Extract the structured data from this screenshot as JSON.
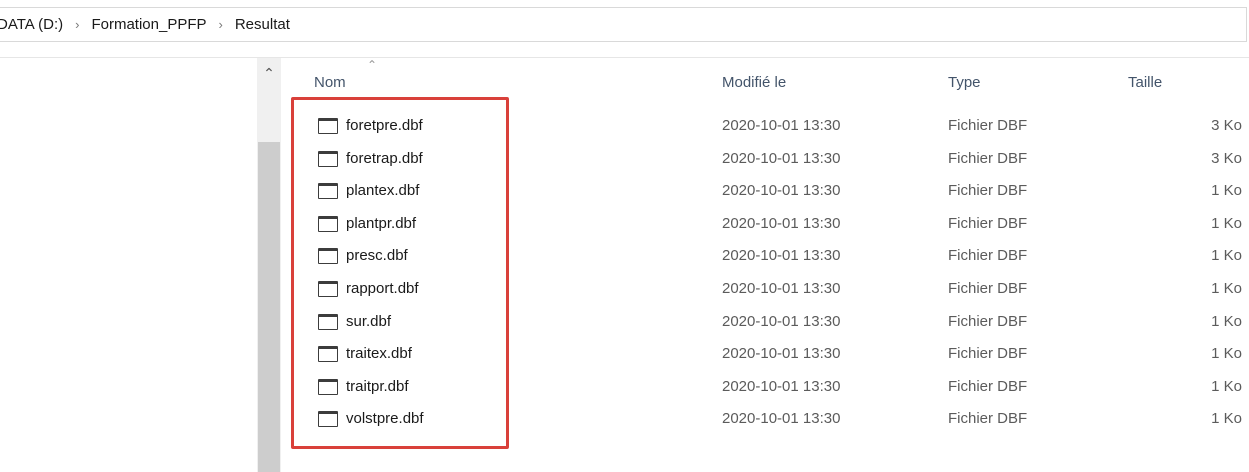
{
  "breadcrumb": {
    "items": [
      "DATA (D:)",
      "Formation_PPFP",
      "Resultat"
    ],
    "separator": "›"
  },
  "columns": {
    "name": "Nom",
    "modified": "Modifié le",
    "type": "Type",
    "size": "Taille"
  },
  "files": [
    {
      "name": "foretpre.dbf",
      "modified": "2020-10-01 13:30",
      "type": "Fichier DBF",
      "size": "3 Ko"
    },
    {
      "name": "foretrap.dbf",
      "modified": "2020-10-01 13:30",
      "type": "Fichier DBF",
      "size": "3 Ko"
    },
    {
      "name": "plantex.dbf",
      "modified": "2020-10-01 13:30",
      "type": "Fichier DBF",
      "size": "1 Ko"
    },
    {
      "name": "plantpr.dbf",
      "modified": "2020-10-01 13:30",
      "type": "Fichier DBF",
      "size": "1 Ko"
    },
    {
      "name": "presc.dbf",
      "modified": "2020-10-01 13:30",
      "type": "Fichier DBF",
      "size": "1 Ko"
    },
    {
      "name": "rapport.dbf",
      "modified": "2020-10-01 13:30",
      "type": "Fichier DBF",
      "size": "1 Ko"
    },
    {
      "name": "sur.dbf",
      "modified": "2020-10-01 13:30",
      "type": "Fichier DBF",
      "size": "1 Ko"
    },
    {
      "name": "traitex.dbf",
      "modified": "2020-10-01 13:30",
      "type": "Fichier DBF",
      "size": "1 Ko"
    },
    {
      "name": "traitpr.dbf",
      "modified": "2020-10-01 13:30",
      "type": "Fichier DBF",
      "size": "1 Ko"
    },
    {
      "name": "volstpre.dbf",
      "modified": "2020-10-01 13:30",
      "type": "Fichier DBF",
      "size": "1 Ko"
    }
  ],
  "icons": {
    "file": "file-window-icon",
    "scroll_up": "chevron-up-icon",
    "sort": "sort-ascending-icon"
  },
  "colors": {
    "highlight": "#d9403a",
    "header_text": "#43546a"
  }
}
